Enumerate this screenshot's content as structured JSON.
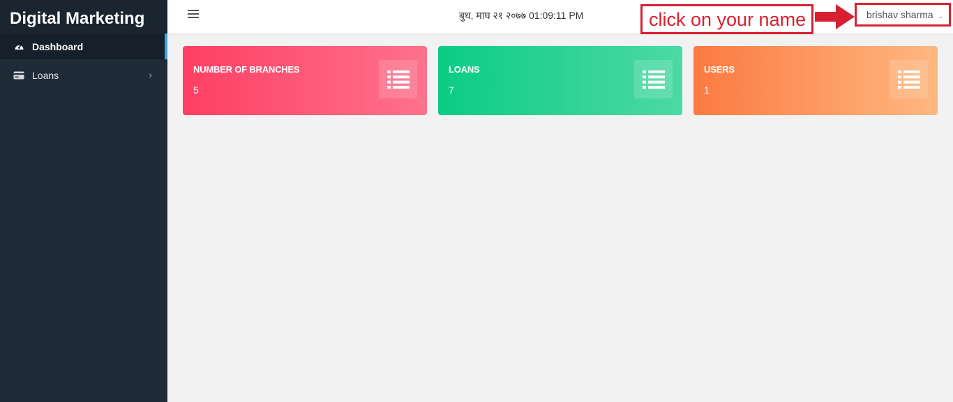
{
  "app": {
    "brand": "Digital Marketing"
  },
  "sidebar": {
    "items": [
      {
        "label": "Dashboard",
        "icon": "dashboard-gauge-icon",
        "active": true
      },
      {
        "label": "Loans",
        "icon": "credit-card-icon",
        "chevron": "›"
      }
    ]
  },
  "topbar": {
    "datetime": "बुध, माघ २१ २०७७ 01:09:11 PM",
    "user_name": "brishav sharma",
    "user_caret": "⌄"
  },
  "annotation": {
    "text": "click on your name",
    "color": "#d92030"
  },
  "cards": [
    {
      "label": "NUMBER OF BRANCHES",
      "value": "5",
      "icon": "list-icon",
      "color": "#fe3f63"
    },
    {
      "label": "LOANS",
      "value": "7",
      "icon": "list-icon",
      "color": "#0bcc84"
    },
    {
      "label": "USERS",
      "value": "1",
      "icon": "list-icon",
      "color": "#fc7a42"
    }
  ]
}
